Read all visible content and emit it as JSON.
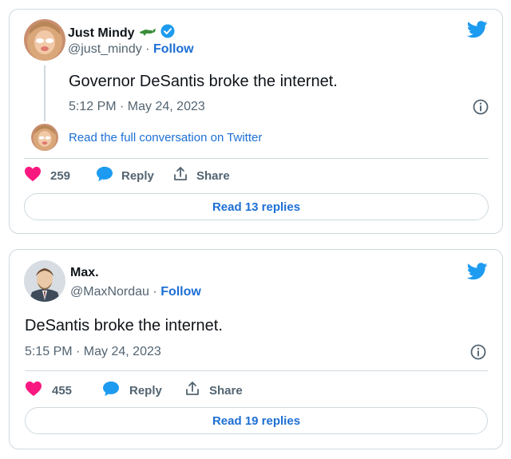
{
  "colors": {
    "accent": "#1d9bf0",
    "link": "#1d6fd4",
    "like": "#f91880",
    "text": "#0f1419",
    "muted": "#536471",
    "border": "#cfd9de"
  },
  "tweets": [
    {
      "display_name": "Just Mindy",
      "handle": "@just_mindy",
      "separator": "·",
      "follow_label": "Follow",
      "verified": true,
      "name_emoji_icon": "crocodile-icon",
      "text": "Governor DeSantis broke the internet.",
      "timestamp": "5:12 PM · May 24, 2023",
      "conversation_link": "Read the full conversation on Twitter",
      "likes": "259",
      "reply_label": "Reply",
      "share_label": "Share",
      "read_replies": "Read 13 replies"
    },
    {
      "display_name": "Max.",
      "handle": "@MaxNordau",
      "separator": "·",
      "follow_label": "Follow",
      "verified": false,
      "text": "DeSantis broke the internet.",
      "timestamp": "5:15 PM · May 24, 2023",
      "likes": "455",
      "reply_label": "Reply",
      "share_label": "Share",
      "read_replies": "Read 19 replies"
    }
  ]
}
